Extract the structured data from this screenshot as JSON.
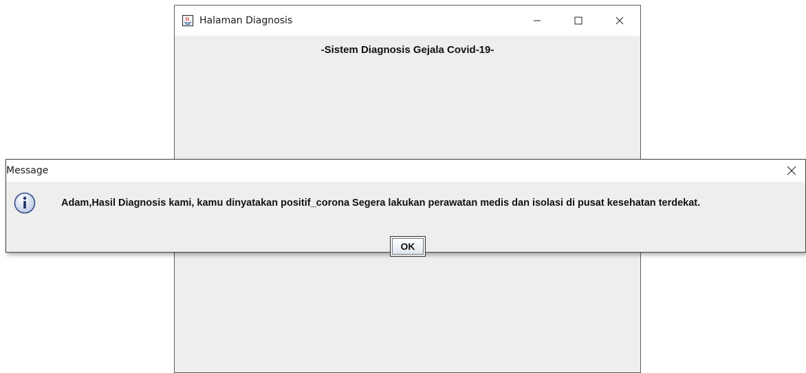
{
  "main_window": {
    "title": "Halaman Diagnosis",
    "heading": "-Sistem Diagnosis Gejala Covid-19-",
    "icon": "java-app-icon",
    "controls": [
      "minimize-icon",
      "maximize-icon",
      "close-icon"
    ]
  },
  "dialog": {
    "title": "Message",
    "icon": "info-icon",
    "message": "Adam,Hasil Diagnosis kami, kamu dinyatakan positif_corona Segera lakukan perawatan medis dan isolasi di pusat kesehatan terdekat.",
    "ok_label": "OK"
  }
}
